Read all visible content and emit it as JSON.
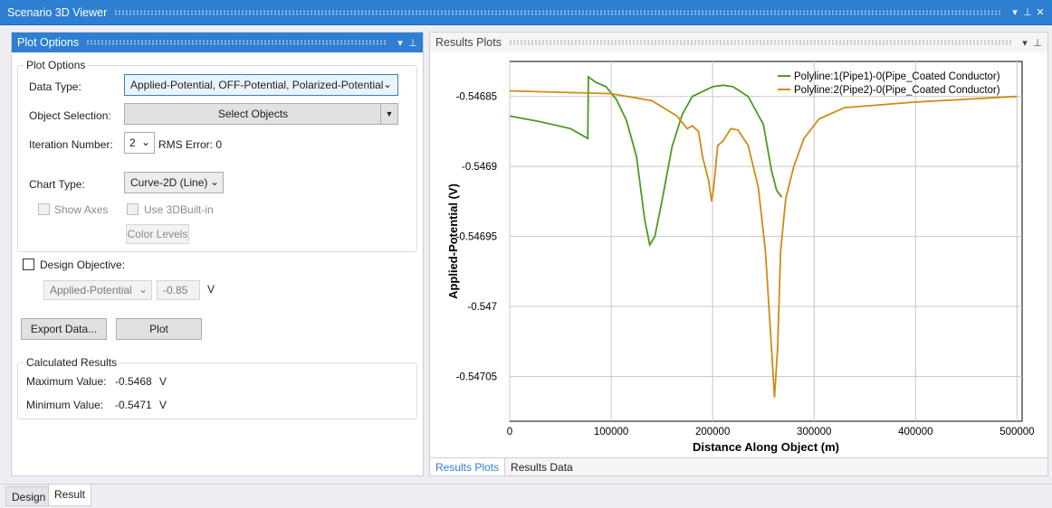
{
  "window": {
    "title": "Scenario 3D Viewer"
  },
  "left_pane": {
    "title": "Plot Options",
    "group_plot_options": "Plot Options",
    "data_type_label": "Data Type:",
    "data_type_value": "Applied-Potential, OFF-Potential, Polarized-Potential",
    "object_selection_label": "Object Selection:",
    "select_objects_button": "Select Objects",
    "iteration_label": "Iteration Number:",
    "iteration_value": "2",
    "rms_error": "RMS Error: 0",
    "chart_type_label": "Chart Type:",
    "chart_type_value": "Curve-2D (Line)",
    "show_axes_label": "Show Axes",
    "use_3d_label": "Use 3DBuilt-in",
    "color_levels_button": "Color Levels",
    "design_objective_label": "Design Objective:",
    "design_objective_combo": "Applied-Potential",
    "design_objective_value": "-0.85",
    "design_objective_unit": "V",
    "export_button": "Export Data...",
    "plot_button": "Plot",
    "calc_group": "Calculated Results",
    "max_label": "Maximum Value:",
    "max_value": "-0.5468",
    "max_unit": "V",
    "min_label": "Minimum Value:",
    "min_value": "-0.5471",
    "min_unit": "V"
  },
  "right_pane": {
    "title": "Results Plots",
    "tabs": [
      "Results Plots",
      "Results Data"
    ]
  },
  "doc_tabs": [
    "Design",
    "Result"
  ],
  "colors": {
    "accent": "#2e7fd2",
    "series1": "#4d9a20",
    "series2": "#cc8d13"
  },
  "chart_data": {
    "type": "line",
    "xlabel": "Distance Along Object (m)",
    "ylabel": "Applied-Potential (V)",
    "xlim": [
      0,
      505000
    ],
    "ylim": [
      -0.547082,
      -0.546825
    ],
    "xticks": [
      0,
      100000,
      200000,
      300000,
      400000,
      500000
    ],
    "xtick_labels": [
      "0",
      "100000",
      "200000",
      "300000",
      "400000",
      "500000"
    ],
    "yticks": [
      -0.54685,
      -0.5469,
      -0.54695,
      -0.547,
      -0.54705
    ],
    "ytick_labels": [
      "-0.54685",
      "-0.5469",
      "-0.54695",
      "-0.547",
      "-0.54705"
    ],
    "grid": true,
    "legend_position": "top-right",
    "series": [
      {
        "name": "Polyline:1(Pipe1)-0(Pipe_Coated Conductor)",
        "x": [
          0,
          30000,
          60000,
          77000,
          77500,
          85000,
          95000,
          105000,
          115000,
          125000,
          133000,
          138000,
          143000,
          150000,
          160000,
          170000,
          180000,
          200000,
          210000,
          220000,
          235000,
          250000,
          258000,
          263000,
          268000
        ],
        "y": [
          -0.546864,
          -0.546868,
          -0.546873,
          -0.54688,
          -0.546836,
          -0.54684,
          -0.546843,
          -0.546852,
          -0.546867,
          -0.546893,
          -0.546938,
          -0.546956,
          -0.54695,
          -0.546925,
          -0.546886,
          -0.546863,
          -0.54685,
          -0.546843,
          -0.546842,
          -0.546843,
          -0.54685,
          -0.54687,
          -0.546903,
          -0.546917,
          -0.546922
        ]
      },
      {
        "name": "Polyline:2(Pipe2)-0(Pipe_Coated Conductor)",
        "x": [
          0,
          50000,
          100000,
          140000,
          165000,
          175000,
          180000,
          186000,
          190000,
          196000,
          199000,
          201000,
          205000,
          210000,
          218000,
          225000,
          235000,
          245000,
          252000,
          258000,
          261000,
          264000,
          267000,
          272000,
          280000,
          290000,
          305000,
          330000,
          400000,
          500000
        ],
        "y": [
          -0.546846,
          -0.546847,
          -0.546848,
          -0.546853,
          -0.546864,
          -0.546873,
          -0.546871,
          -0.546875,
          -0.546893,
          -0.54691,
          -0.546925,
          -0.546915,
          -0.546885,
          -0.546882,
          -0.546873,
          -0.546874,
          -0.546885,
          -0.546915,
          -0.54696,
          -0.54703,
          -0.547065,
          -0.54703,
          -0.54696,
          -0.546923,
          -0.5469,
          -0.54688,
          -0.546866,
          -0.546858,
          -0.546854,
          -0.54685
        ]
      }
    ]
  }
}
